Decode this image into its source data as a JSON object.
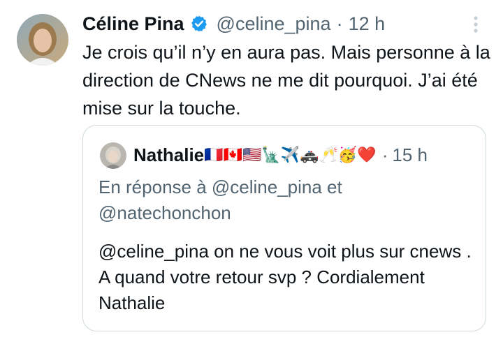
{
  "tweet": {
    "author_name": "Céline Pina",
    "verified": true,
    "handle": "@celine_pina",
    "separator": "·",
    "time": "12 h",
    "text": "Je crois qu’il n’y en aura pas. Mais personne à la direction de CNews ne me dit pourquoi. J’ai été mise sur la touche."
  },
  "quote": {
    "author_name": "Nathalie",
    "name_emojis": "🇫🇷🇨🇦🇺🇸🗽✈️🚓🥂🥳❤️",
    "separator": "·",
    "time": "15 h",
    "reply_to": "En réponse à @celine_pina et @natechonchon",
    "text": "@celine_pina on ne vous voit plus sur cnews . A quand votre retour svp ? Cordialement Nathalie"
  },
  "colors": {
    "primary_text": "#0f1419",
    "secondary_text": "#536471",
    "verified_blue": "#1d9bf0",
    "border": "#cfd9de"
  },
  "icons": {
    "verified": "verified-badge-icon",
    "more": "more-options-icon"
  }
}
